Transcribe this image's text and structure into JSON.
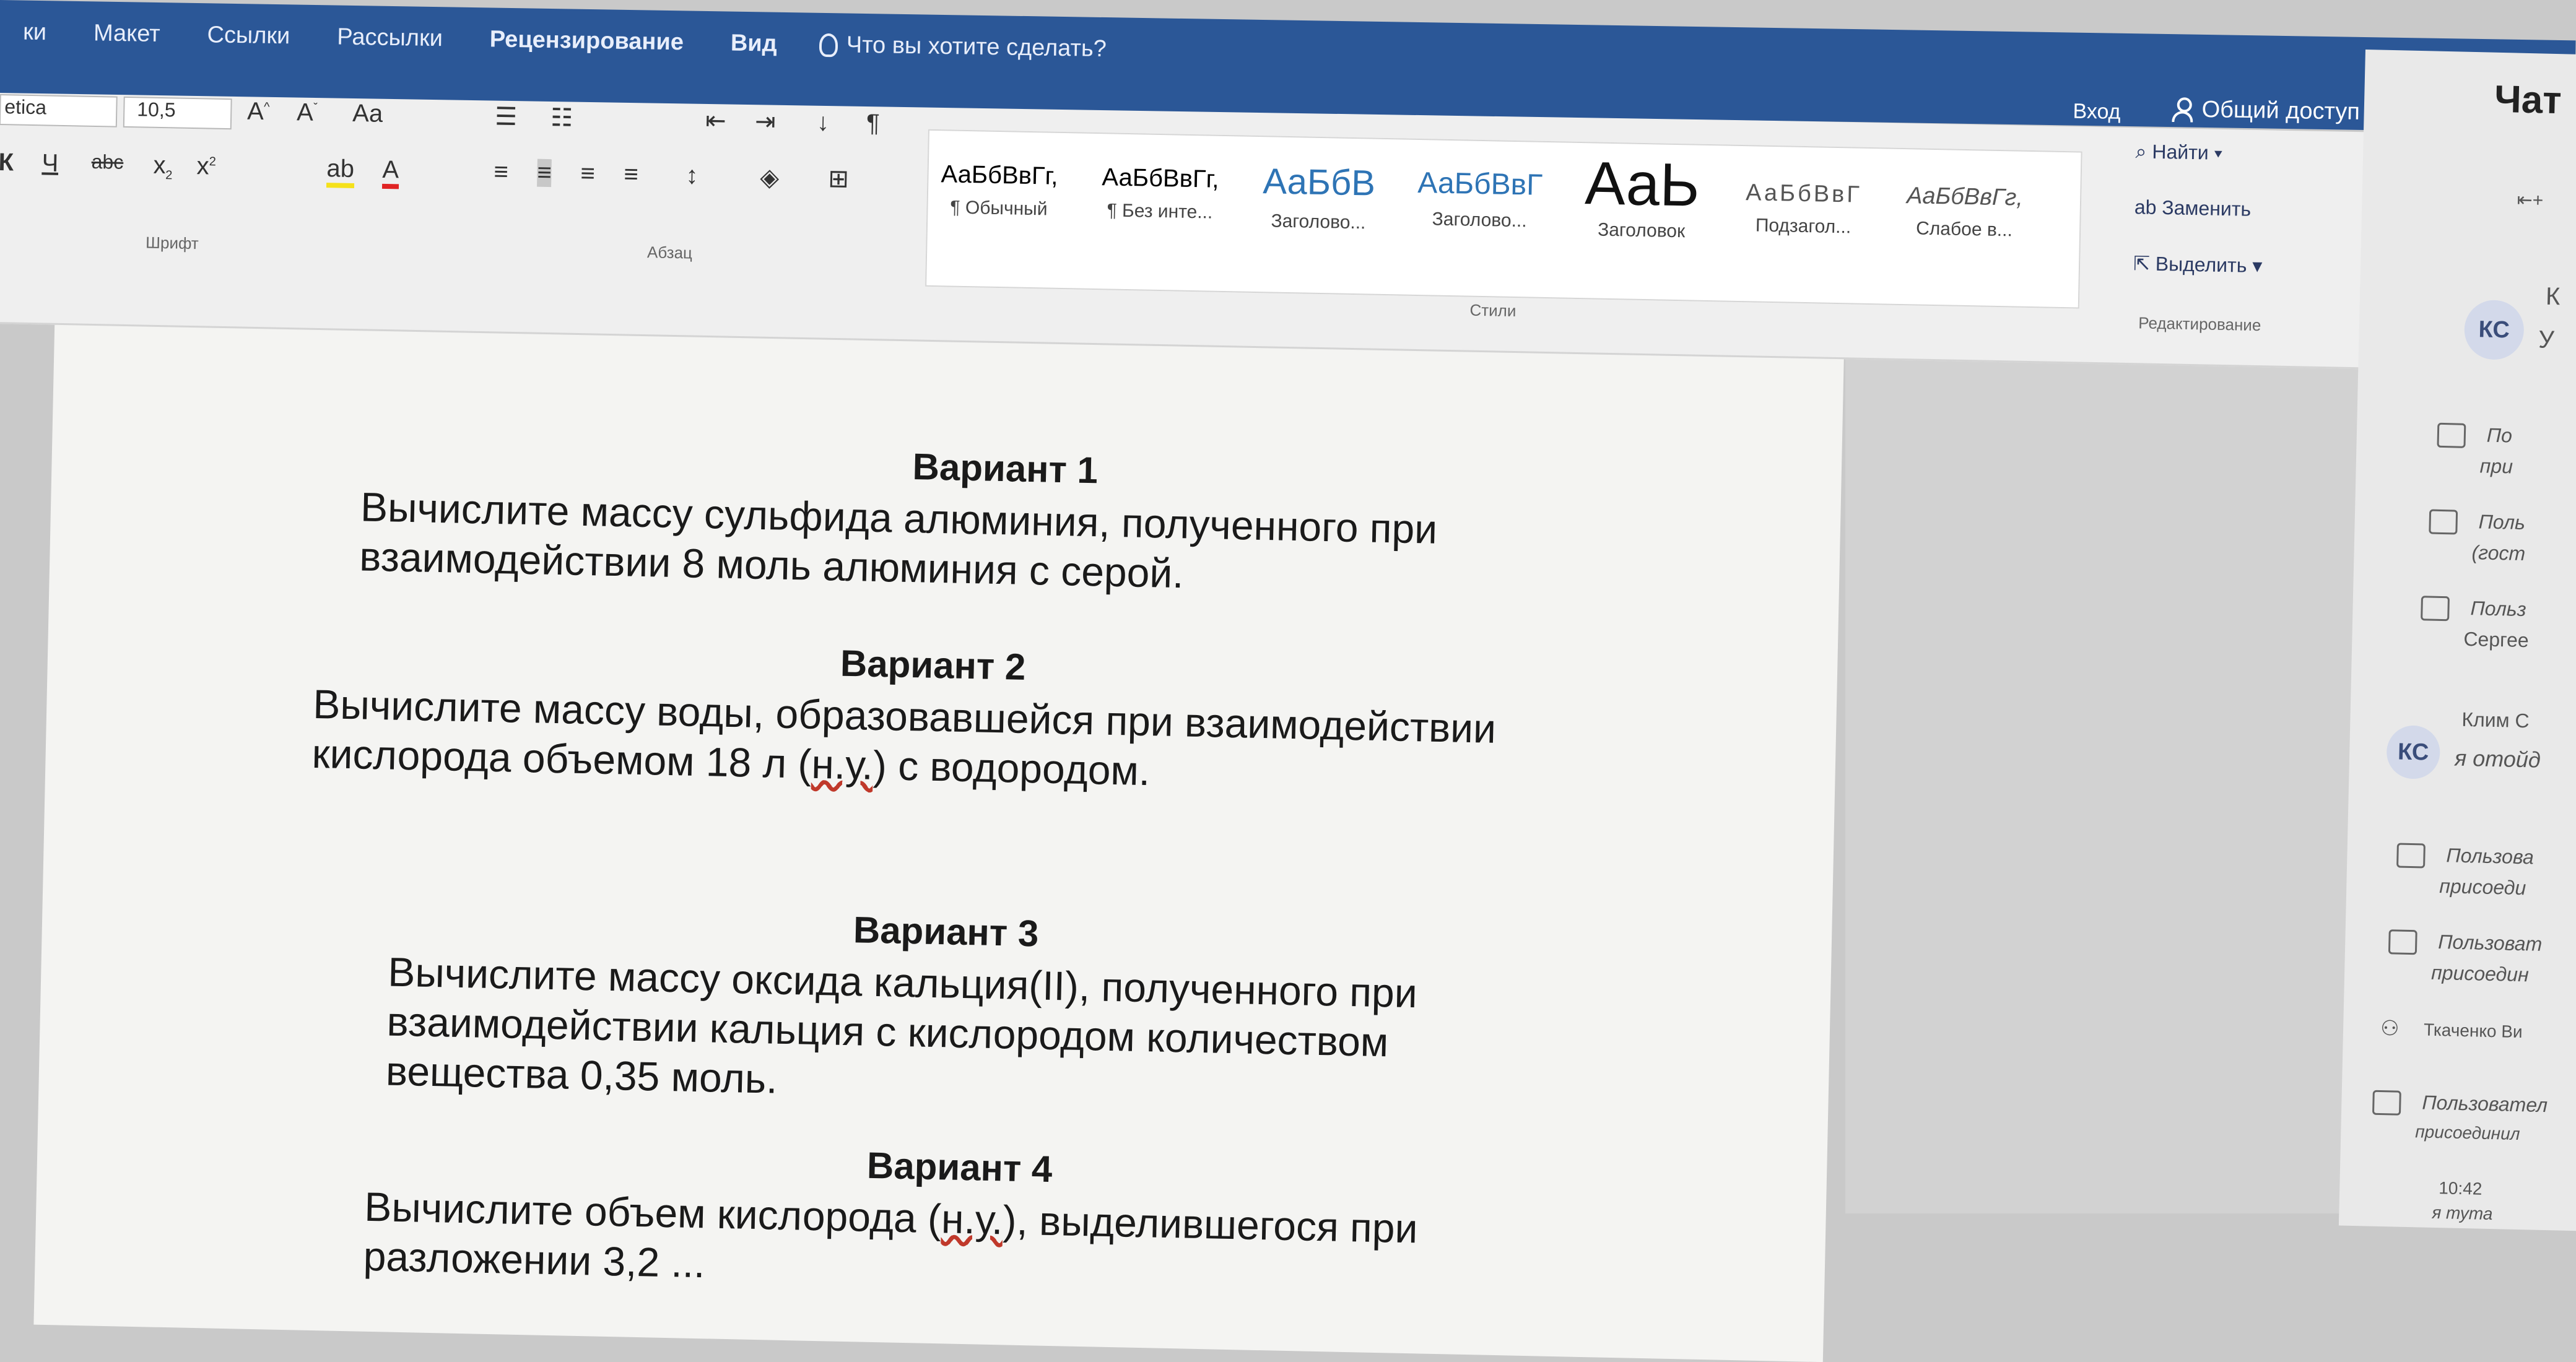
{
  "menu": {
    "tabs": [
      "ки",
      "Макет",
      "Ссылки",
      "Рассылки",
      "Рецензирование",
      "Вид"
    ],
    "search_hint": "Что вы хотите сделать?",
    "login": "Вход",
    "share": "Общий доступ"
  },
  "ribbon": {
    "font_name": "etica",
    "font_size": "10,5",
    "font_group_label": "Шрифт",
    "paragraph_group_label": "Абзац",
    "styles_group_label": "Стили",
    "editing_group_label": "Редактирование",
    "styles": [
      {
        "sample": "АаБбВвГг,",
        "name": "¶ Обычный"
      },
      {
        "sample": "АаБбВвГг,",
        "name": "¶ Без инте..."
      },
      {
        "sample": "АаБбВ",
        "name": "Заголово..."
      },
      {
        "sample": "АаБбВвГ",
        "name": "Заголово..."
      },
      {
        "sample": "АаЬ",
        "name": "Заголовок"
      },
      {
        "sample": "АаБбВвГ",
        "name": "Подзагол..."
      },
      {
        "sample": "АаБбВвГг,",
        "name": "Слабое в..."
      }
    ],
    "editing": {
      "find": "Найти",
      "replace": "Заменить",
      "select": "Выделить"
    }
  },
  "document": {
    "variants": [
      {
        "heading": "Вариант 1",
        "lines": [
          "Вычислите массу сульфида алюминия, полученного при",
          "взаимодействии 8 моль алюминия с серой."
        ]
      },
      {
        "heading": "Вариант 2",
        "lines": [
          "Вычислите массу воды, образовавшейся при взаимодействии",
          "кислорода объемом 18 л (н.у.) с водородом."
        ]
      },
      {
        "heading": "Вариант 3",
        "lines": [
          "Вычислите массу оксида кальция(II), полученного при",
          "взаимодействии кальция с кислородом количеством",
          "вещества 0,35 моль."
        ]
      },
      {
        "heading": "Вариант 4",
        "lines": [
          "Вычислите объем кислорода (н.у.), выделившегося при",
          "разложении 3,2 ..."
        ]
      }
    ]
  },
  "chat": {
    "title": "Чат",
    "items": [
      {
        "type": "avatar",
        "initials": "КС",
        "text": "К",
        "sub": "У"
      },
      {
        "type": "icon",
        "text": "По",
        "sub": "при"
      },
      {
        "type": "icon",
        "text": "Поль",
        "sub": "(гост"
      },
      {
        "type": "icon",
        "text": "Польз",
        "sub": "Сергее"
      },
      {
        "type": "avatar",
        "initials": "КС",
        "text": "Клим С",
        "sub": "я отойд"
      },
      {
        "type": "icon",
        "text": "Пользова",
        "sub": "присоеди"
      },
      {
        "type": "icon",
        "text": "Пользоват",
        "sub": "присоедин"
      },
      {
        "type": "icon",
        "text": "Ткаченко Ви",
        "sub": ""
      },
      {
        "type": "icon",
        "text": "Пользовател",
        "sub": "присоединил"
      },
      {
        "type": "time",
        "text": "10:42",
        "sub": "я тута"
      }
    ]
  }
}
